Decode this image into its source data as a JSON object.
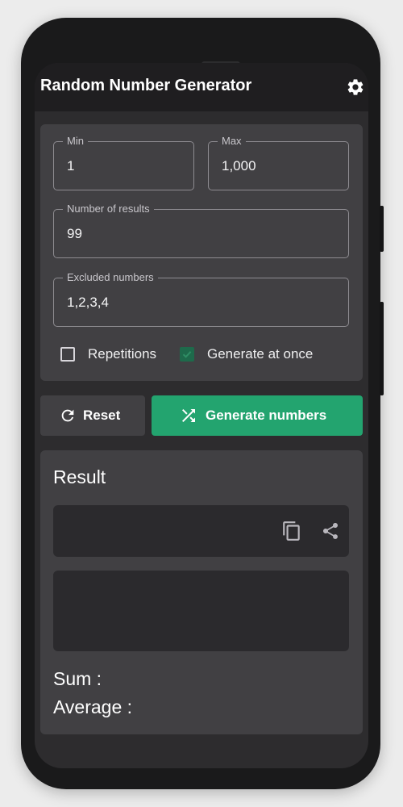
{
  "app": {
    "title": "Random Number Generator"
  },
  "form": {
    "min": {
      "label": "Min",
      "value": "1"
    },
    "max": {
      "label": "Max",
      "value": "1,000"
    },
    "number_of_results": {
      "label": "Number of results",
      "value": "99"
    },
    "excluded_numbers": {
      "label": "Excluded numbers",
      "value": "1,2,3,4"
    },
    "repetitions": {
      "label": "Repetitions",
      "checked": false
    },
    "generate_at_once": {
      "label": "Generate at once",
      "checked": true
    }
  },
  "actions": {
    "reset_label": "Reset",
    "generate_label": "Generate numbers"
  },
  "result": {
    "title": "Result",
    "sum_label": "Sum :",
    "average_label": "Average :"
  },
  "icons": {
    "settings": "gear-icon",
    "reset": "refresh-icon",
    "generate": "shuffle-icon",
    "copy": "copy-icon",
    "share": "share-icon"
  },
  "colors": {
    "accent": "#23a46f",
    "surface": "#414043",
    "background": "#2d2c2e",
    "appbar": "#1f1e20"
  }
}
